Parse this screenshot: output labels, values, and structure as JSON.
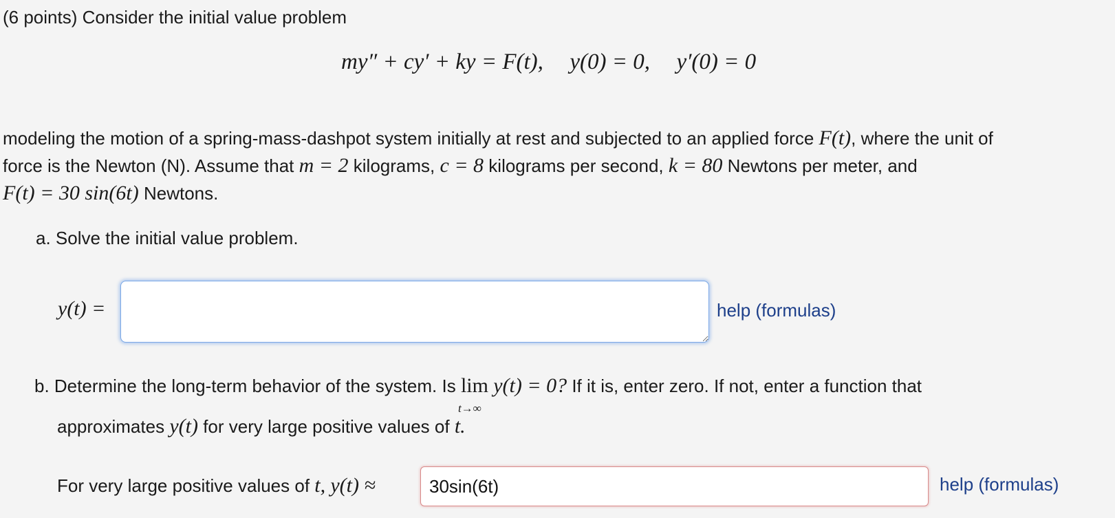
{
  "header": {
    "intro": "(6 points) Consider the initial value problem"
  },
  "ivp": {
    "equation_lhs": "my″ + cy′ + ky = F(t),",
    "ic1": "y(0) = 0,",
    "ic2": "y′(0) = 0"
  },
  "description": {
    "line1_text": "modeling the motion of a spring-mass-dashpot system initially at rest and subjected to an applied force",
    "line1_math": "F(t)",
    "line1_tail": ", where the unit of",
    "line2_a": "force is the Newton (N). Assume that",
    "m_eq": "m = 2",
    "line2_b": "kilograms,",
    "c_eq": "c = 8",
    "line2_c": "kilograms per second,",
    "k_eq": "k = 80",
    "line2_d": "Newtons per meter, and",
    "F_eq": "F(t) = 30 sin(6t)",
    "line3_tail": "Newtons."
  },
  "part_a": {
    "prompt": "a. Solve the initial value problem.",
    "answer_label": "y(t) =",
    "answer_value": "",
    "help_label": "help (formulas)"
  },
  "part_b": {
    "prompt_pre": "b. Determine the long-term behavior of the system. Is",
    "lim_word": "lim",
    "lim_sub": "t→∞",
    "lim_expr": "y(t) = 0?",
    "prompt_post": "If it is, enter zero. If not, enter a function that",
    "line2_pre": "approximates",
    "line2_math": "y(t)",
    "line2_mid": "for very large positive values of",
    "line2_var": "t.",
    "answer_pre": "For very large positive values of",
    "answer_t": "t,",
    "answer_approx": "y(t) ≈",
    "answer_value": "30sin(6t)",
    "help_label": "help (formulas)"
  }
}
